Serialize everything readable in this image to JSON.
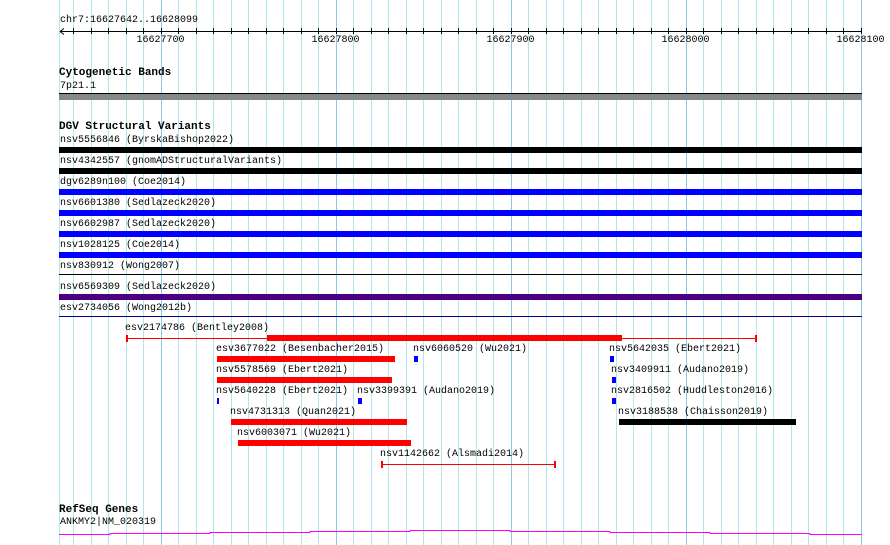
{
  "position": "chr7:16627642..16628099",
  "view": {
    "start": 16627642,
    "end": 16628100
  },
  "ruler": {
    "ticks": [
      16627700,
      16627800,
      16627900,
      16628000,
      16628100
    ]
  },
  "cyto": {
    "title": "Cytogenetic Bands",
    "band": "7p21.1",
    "color": "#888888"
  },
  "dgv": {
    "title": "DGV Structural Variants",
    "full_rows": [
      {
        "label": "nsv5556846 (ByrskaBishop2022)",
        "color": "#000000",
        "style": "thick"
      },
      {
        "label": "nsv4342557 (gnomADStructuralVariants)",
        "color": "#000000",
        "style": "thick"
      },
      {
        "label": "dgv6289n100 (Coe2014)",
        "color": "#0000ff",
        "style": "thick"
      },
      {
        "label": "nsv6601380 (Sedlazeck2020)",
        "color": "#0000ff",
        "style": "thick"
      },
      {
        "label": "nsv6602987 (Sedlazeck2020)",
        "color": "#0000ff",
        "style": "thick"
      },
      {
        "label": "nsv1028125 (Coe2014)",
        "color": "#0000ff",
        "style": "thick"
      },
      {
        "label": "nsv830912 (Wong2007)",
        "color": "#000000",
        "style": "thin"
      },
      {
        "label": "nsv6569309 (Sedlazeck2020)",
        "color": "#4b0082",
        "style": "thick"
      },
      {
        "label": "esv2734056 (Wong2012b)",
        "color": "#000080",
        "style": "thin"
      }
    ],
    "features": [
      {
        "label": "esv2174786 (Bentley2008)",
        "start": 16627680,
        "end": 16628041,
        "thickStart": 16627761,
        "thickEnd": 16627964,
        "color": "#ff0000"
      },
      {
        "label": "esv3677022 (Besenbacher2015)",
        "start": 16627732,
        "end": 16627834,
        "color": "#ff0000"
      },
      {
        "label": "nsv6060520 (Wu2021)",
        "start": 16627845,
        "end": 16627847,
        "color": "#0000ff"
      },
      {
        "label": "nsv5642035 (Ebert2021)",
        "start": 16627957,
        "end": 16627959,
        "color": "#0000ff"
      },
      {
        "label": "nsv5578569 (Ebert2021)",
        "start": 16627732,
        "end": 16627832,
        "color": "#ff0000"
      },
      {
        "label": "nsv3409911 (Audano2019)",
        "start": 16627958,
        "end": 16627960,
        "color": "#0000ff"
      },
      {
        "label": "nsv5640228 (Ebert2021)",
        "start": 16627732,
        "end": 16627733,
        "color": "#0000ff"
      },
      {
        "label": "nsv3399391 (Audano2019)",
        "start": 16627813,
        "end": 16627815,
        "color": "#0000ff"
      },
      {
        "label": "nsv2816502 (Huddleston2016)",
        "start": 16627958,
        "end": 16627960,
        "color": "#0000ff"
      },
      {
        "label": "nsv4731313 (Quan2021)",
        "start": 16627740,
        "end": 16627841,
        "color": "#ff0000"
      },
      {
        "label": "nsv3188538 (Chaisson2019)",
        "start": 16627962,
        "end": 16628063,
        "color": "#000000"
      },
      {
        "label": "nsv6003071 (Wu2021)",
        "start": 16627744,
        "end": 16627843,
        "color": "#ff0000"
      },
      {
        "label": "nsv1142662 (Alsmadi2014)",
        "start": 16627826,
        "end": 16627926,
        "thickStart": 16627826,
        "thickEnd": 16627826,
        "color": "#ff0000"
      }
    ]
  },
  "refseq": {
    "title": "RefSeq Genes",
    "gene": "ANKMY2|NM_020319",
    "color": "#ff00ff"
  }
}
